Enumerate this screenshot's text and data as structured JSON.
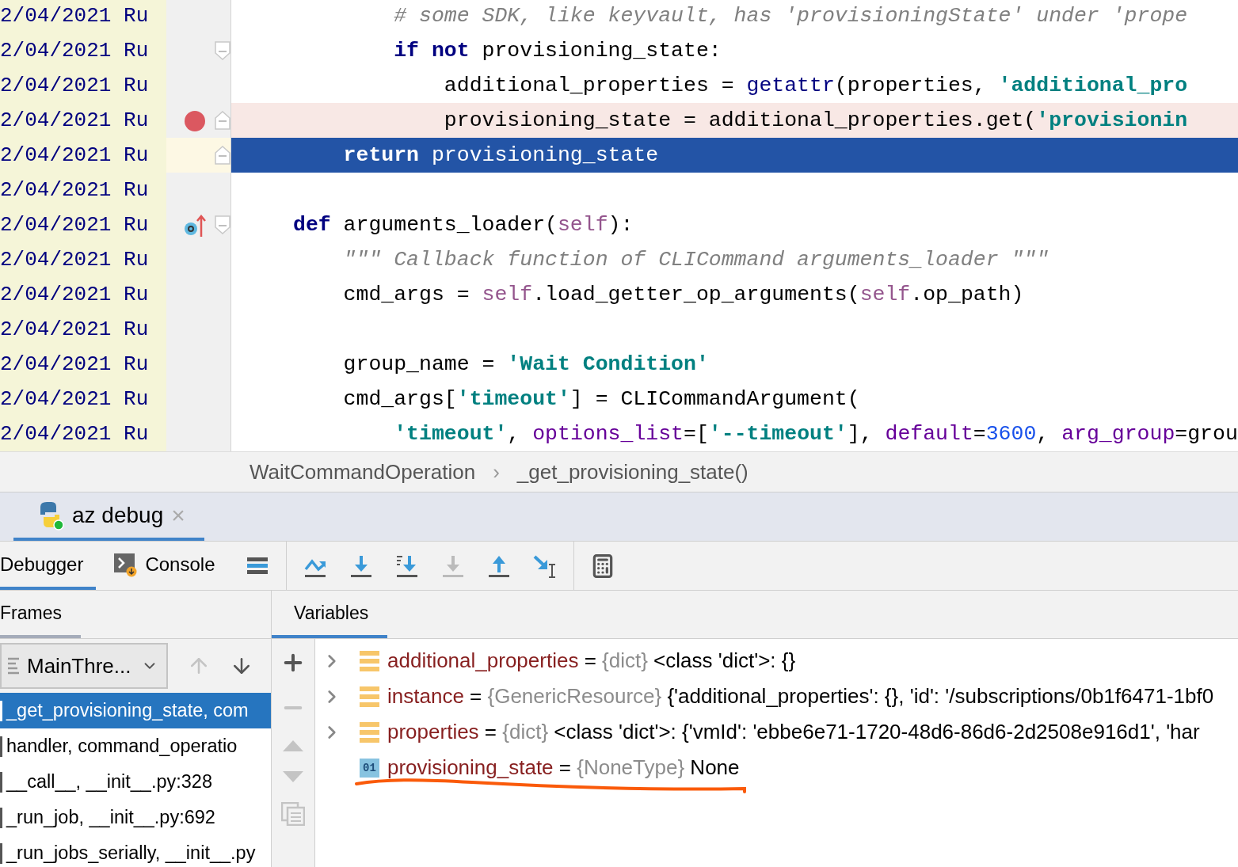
{
  "editor": {
    "lines": [
      {
        "annotation": "2/04/2021 Ru",
        "breakpoint": false,
        "current": false,
        "smart_step": false,
        "tokens": [
          {
            "kind": "cmt",
            "text": "        # some SDK, like keyvault, has 'provisioningState' under 'prope"
          }
        ]
      },
      {
        "annotation": "2/04/2021 Ru",
        "breakpoint": false,
        "current": false,
        "smart_step": false,
        "fold": {
          "kind": "start"
        },
        "tokens": [
          {
            "kind": "kw",
            "text": "        if not"
          },
          {
            "kind": "text",
            "text": " provisioning_state:"
          }
        ]
      },
      {
        "annotation": "2/04/2021 Ru",
        "breakpoint": false,
        "current": false,
        "smart_step": false,
        "tokens": [
          {
            "kind": "text",
            "text": "            additional_properties = "
          },
          {
            "kind": "builtin",
            "text": "getattr"
          },
          {
            "kind": "text",
            "text": "(properties, "
          },
          {
            "kind": "str",
            "text": "'additional_pro"
          }
        ]
      },
      {
        "annotation": "2/04/2021 Ru",
        "breakpoint": true,
        "current": false,
        "smart_step": false,
        "fold": {
          "kind": "end"
        },
        "tokens": [
          {
            "kind": "text",
            "text": "            provisioning_state = additional_properties.get("
          },
          {
            "kind": "str",
            "text": "'provisionin"
          }
        ]
      },
      {
        "annotation": "2/04/2021 Ru",
        "breakpoint": false,
        "current": true,
        "smart_step": false,
        "fold": {
          "kind": "end"
        },
        "tokens": [
          {
            "kind": "kw",
            "text": "    return"
          },
          {
            "kind": "text",
            "text": " provisioning_state"
          }
        ]
      },
      {
        "annotation": "2/04/2021 Ru",
        "breakpoint": false,
        "current": false,
        "smart_step": false
      },
      {
        "annotation": "2/04/2021 Ru",
        "breakpoint": false,
        "current": false,
        "smart_step": true,
        "fold": {
          "kind": "start"
        },
        "tokens": [
          {
            "kind": "kw",
            "text": "def"
          },
          {
            "kind": "text",
            "text": " arguments_loader("
          },
          {
            "kind": "self",
            "text": "self"
          },
          {
            "kind": "text",
            "text": "):"
          }
        ]
      },
      {
        "annotation": "2/04/2021 Ru",
        "breakpoint": false,
        "current": false,
        "smart_step": false,
        "tokens": [
          {
            "kind": "cmt",
            "text": "    \"\"\" Callback function of CLICommand arguments_loader \"\"\""
          }
        ]
      },
      {
        "annotation": "2/04/2021 Ru",
        "breakpoint": false,
        "current": false,
        "smart_step": false,
        "tokens": [
          {
            "kind": "text",
            "text": "    cmd_args = "
          },
          {
            "kind": "self",
            "text": "self"
          },
          {
            "kind": "text",
            "text": ".load_getter_op_arguments("
          },
          {
            "kind": "self",
            "text": "self"
          },
          {
            "kind": "text",
            "text": ".op_path)"
          }
        ]
      },
      {
        "annotation": "2/04/2021 Ru",
        "breakpoint": false,
        "current": false,
        "smart_step": false
      },
      {
        "annotation": "2/04/2021 Ru",
        "breakpoint": false,
        "current": false,
        "smart_step": false,
        "tokens": [
          {
            "kind": "text",
            "text": "    group_name = "
          },
          {
            "kind": "str",
            "text": "'Wait Condition'"
          }
        ]
      },
      {
        "annotation": "2/04/2021 Ru",
        "breakpoint": false,
        "current": false,
        "smart_step": false,
        "tokens": [
          {
            "kind": "text",
            "text": "    cmd_args["
          },
          {
            "kind": "str",
            "text": "'timeout'"
          },
          {
            "kind": "text",
            "text": "] = CLICommandArgument("
          }
        ]
      },
      {
        "annotation": "2/04/2021 Ru",
        "breakpoint": false,
        "current": false,
        "smart_step": false,
        "tokens": [
          {
            "kind": "str",
            "text": "        'timeout'"
          },
          {
            "kind": "text",
            "text": ", "
          },
          {
            "kind": "kwarg",
            "text": "options_list"
          },
          {
            "kind": "text",
            "text": "=["
          },
          {
            "kind": "str",
            "text": "'--timeout'"
          },
          {
            "kind": "text",
            "text": "], "
          },
          {
            "kind": "kwarg",
            "text": "default"
          },
          {
            "kind": "text",
            "text": "="
          },
          {
            "kind": "num",
            "text": "3600"
          },
          {
            "kind": "text",
            "text": ", "
          },
          {
            "kind": "kwarg",
            "text": "arg_group"
          },
          {
            "kind": "text",
            "text": "=grou"
          }
        ]
      }
    ]
  },
  "breadcrumb": {
    "items": [
      "WaitCommandOperation",
      "_get_provisioning_state()"
    ],
    "separator": "›"
  },
  "run_tabs": [
    {
      "label": "az debug",
      "selected": true,
      "close": "×"
    }
  ],
  "debug_tabs": [
    {
      "label": "Debugger",
      "selected": true
    },
    {
      "label": "Console",
      "selected": false
    }
  ],
  "toolbar_groups": [
    [
      {
        "kind": "layout",
        "disabled": false
      }
    ],
    [
      {
        "kind": "step-over",
        "disabled": false
      },
      {
        "kind": "step-into",
        "disabled": false
      },
      {
        "kind": "step-into-my-code",
        "disabled": false
      },
      {
        "kind": "force-step-into",
        "disabled": true
      },
      {
        "kind": "step-out",
        "disabled": false
      },
      {
        "kind": "run-to-cursor",
        "disabled": false
      }
    ],
    [
      {
        "kind": "evaluate",
        "disabled": false
      }
    ]
  ],
  "frames": {
    "title": "Frames",
    "focused": false,
    "thread": "MainThre...",
    "up_disabled": true,
    "items": [
      {
        "label": "_get_provisioning_state, com",
        "selected": true
      },
      {
        "label": "handler, command_operatio",
        "selected": false
      },
      {
        "label": "__call__, __init__.py:328",
        "selected": false
      },
      {
        "label": "_run_job, __init__.py:692",
        "selected": false
      },
      {
        "label": "_run_jobs_serially, __init__.py",
        "selected": false
      }
    ]
  },
  "variables": {
    "title": "Variables",
    "focused": true,
    "items": [
      {
        "kind": "object",
        "expandable": true,
        "name": "additional_properties",
        "equals": "=",
        "type": "{dict}",
        "value": "<class 'dict'>: {}",
        "underlined": false
      },
      {
        "kind": "object",
        "expandable": true,
        "name": "instance",
        "equals": "=",
        "type": "{GenericResource}",
        "value": "{'additional_properties': {}, 'id': '/subscriptions/0b1f6471-1bf0",
        "underlined": false
      },
      {
        "kind": "object",
        "expandable": true,
        "name": "properties",
        "equals": "=",
        "type": "{dict}",
        "value": "<class 'dict'>: {'vmId': 'ebbe6e71-1720-48d6-86d6-2d2508e916d1', 'har",
        "underlined": false
      },
      {
        "kind": "primitive",
        "expandable": false,
        "badge": "01",
        "name": "provisioning_state",
        "equals": "=",
        "type": "{NoneType}",
        "value": "None",
        "underlined": true
      }
    ]
  }
}
